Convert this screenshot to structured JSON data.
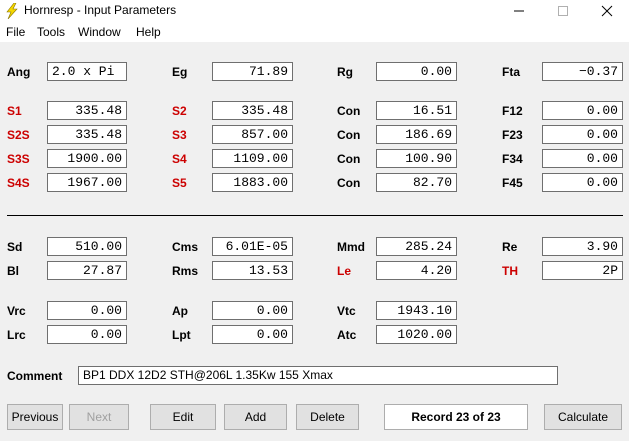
{
  "window": {
    "title": "Hornresp - Input Parameters",
    "icon": "lightning-bolt-icon"
  },
  "menu": [
    "File",
    "Tools",
    "Window",
    "Help"
  ],
  "rows": {
    "r1": [
      {
        "label": "Ang",
        "value": "2.0 x Pi",
        "red": false
      },
      {
        "label": "Eg",
        "value": "71.89",
        "red": false
      },
      {
        "label": "Rg",
        "value": "0.00",
        "red": false
      },
      {
        "label": "Fta",
        "value": "−0.37",
        "red": false
      }
    ],
    "r2": [
      {
        "label": "S1",
        "value": "335.48",
        "red": true
      },
      {
        "label": "S2",
        "value": "335.48",
        "red": true
      },
      {
        "label": "Con",
        "value": "16.51",
        "red": false
      },
      {
        "label": "F12",
        "value": "0.00",
        "red": false
      }
    ],
    "r3": [
      {
        "label": "S2S",
        "value": "335.48",
        "red": true
      },
      {
        "label": "S3",
        "value": "857.00",
        "red": true
      },
      {
        "label": "Con",
        "value": "186.69",
        "red": false
      },
      {
        "label": "F23",
        "value": "0.00",
        "red": false
      }
    ],
    "r4": [
      {
        "label": "S3S",
        "value": "1900.00",
        "red": true
      },
      {
        "label": "S4",
        "value": "1109.00",
        "red": true
      },
      {
        "label": "Con",
        "value": "100.90",
        "red": false
      },
      {
        "label": "F34",
        "value": "0.00",
        "red": false
      }
    ],
    "r5": [
      {
        "label": "S4S",
        "value": "1967.00",
        "red": true
      },
      {
        "label": "S5",
        "value": "1883.00",
        "red": true
      },
      {
        "label": "Con",
        "value": "82.70",
        "red": false
      },
      {
        "label": "F45",
        "value": "0.00",
        "red": false
      }
    ],
    "r6": [
      {
        "label": "Sd",
        "value": "510.00",
        "red": false
      },
      {
        "label": "Cms",
        "value": "6.01E-05",
        "red": false
      },
      {
        "label": "Mmd",
        "value": "285.24",
        "red": false
      },
      {
        "label": "Re",
        "value": "3.90",
        "red": false
      }
    ],
    "r7": [
      {
        "label": "Bl",
        "value": "27.87",
        "red": false
      },
      {
        "label": "Rms",
        "value": "13.53",
        "red": false
      },
      {
        "label": "Le",
        "value": "4.20",
        "red": true
      },
      {
        "label": "TH",
        "value": "2P",
        "red": true
      }
    ],
    "r8": [
      {
        "label": "Vrc",
        "value": "0.00",
        "red": false
      },
      {
        "label": "Ap",
        "value": "0.00",
        "red": false
      },
      {
        "label": "Vtc",
        "value": "1943.10",
        "red": false
      }
    ],
    "r9": [
      {
        "label": "Lrc",
        "value": "0.00",
        "red": false
      },
      {
        "label": "Lpt",
        "value": "0.00",
        "red": false
      },
      {
        "label": "Atc",
        "value": "1020.00",
        "red": false
      }
    ]
  },
  "comment": {
    "label": "Comment",
    "value": "BP1 DDX 12D2 STH@206L 1.35Kw 155 Xmax"
  },
  "buttons": {
    "previous": "Previous",
    "next": "Next",
    "edit": "Edit",
    "add": "Add",
    "delete": "Delete",
    "calculate": "Calculate"
  },
  "record": "Record 23 of 23",
  "colors": {
    "red_label": "#cc0000",
    "icon_yellow": "#f5d800"
  }
}
